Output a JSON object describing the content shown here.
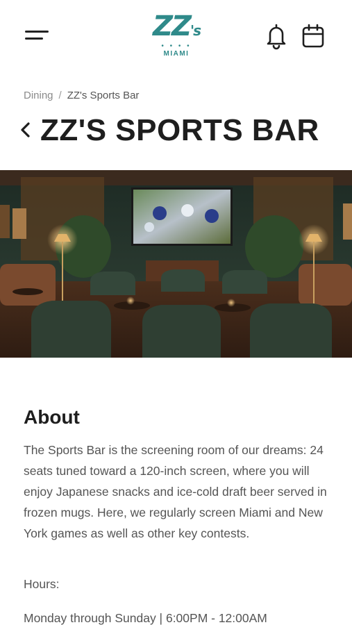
{
  "header": {
    "logo_mark": "ZZ",
    "logo_sup": "'s",
    "logo_dots": "• • • •",
    "logo_sub": "MIAMI",
    "menu_icon": "hamburger-menu-icon",
    "notifications_icon": "bell-icon",
    "calendar_icon": "calendar-icon"
  },
  "breadcrumb": {
    "parent": "Dining",
    "separator": "/",
    "current": "ZZ's Sports Bar"
  },
  "page": {
    "back_icon": "chevron-left-icon",
    "title": "ZZ'S SPORTS BAR"
  },
  "about": {
    "heading": "About",
    "body": "The Sports Bar is the screening room of our dreams: 24 seats tuned toward a 120-inch screen, where you will enjoy Japanese snacks and ice-cold draft beer served in frozen mugs. Here, we regularly screen Miami and New York games as well as other key contests.",
    "hours_label": "Hours:",
    "hours_value": "Monday through Sunday | 6:00PM - 12:00AM"
  },
  "colors": {
    "brand_teal": "#2f8a8a",
    "title_text": "#1e1e1e",
    "body_text": "#555555"
  }
}
